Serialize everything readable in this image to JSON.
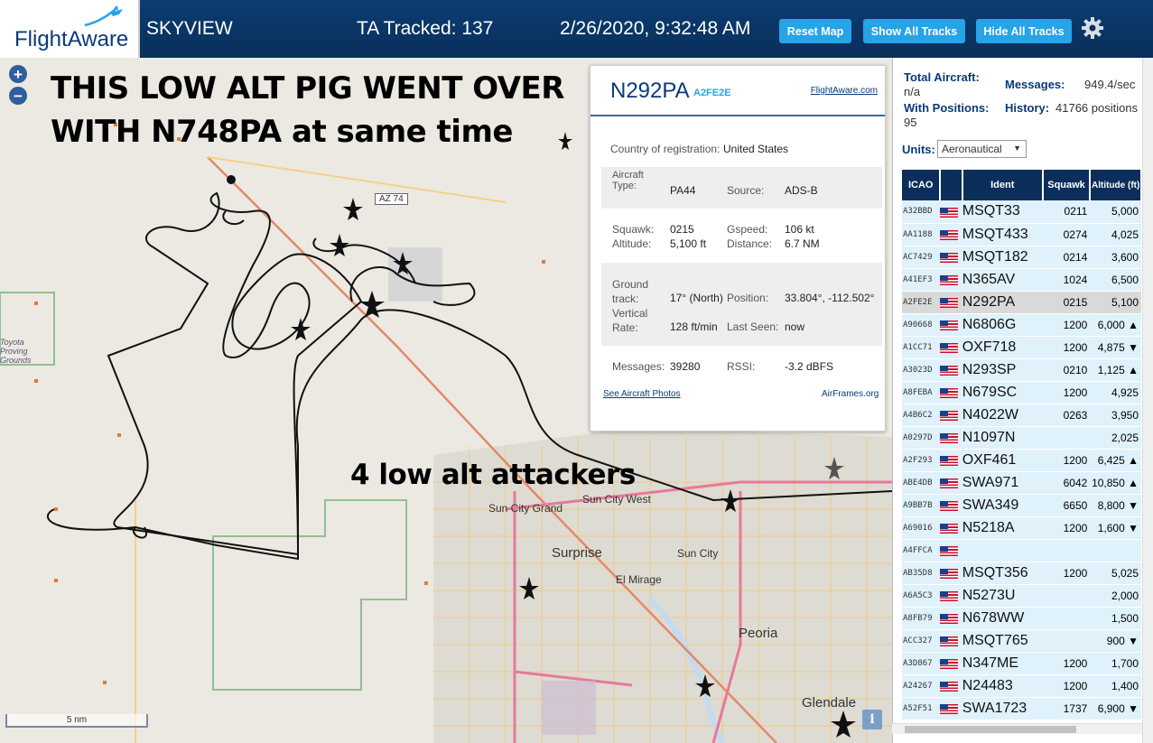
{
  "topbar": {
    "logo_text": "FlightAware",
    "app_name": "SKYVIEW",
    "tracked": "TA Tracked: 137",
    "datetime": "2/26/2020, 9:32:48 AM",
    "reset_map": "Reset Map",
    "show_all": "Show All Tracks",
    "hide_all": "Hide All Tracks",
    "settings_icon": "gear-icon"
  },
  "map": {
    "zoom_in": "+",
    "zoom_out": "−",
    "annotation_1": "THIS LOW ALT PIG WENT OVER",
    "annotation_2": "WITH N748PA at same time",
    "annotation_3": "4 low alt attackers",
    "scale": "5 nm",
    "info": "i",
    "places": {
      "toyota": "Toyota Proving Grounds",
      "sun_city_west": "Sun City West",
      "sun_city_grand": "Sun City Grand",
      "surprise": "Surprise",
      "sun_city": "Sun City",
      "el_mirage": "El Mirage",
      "peoria": "Peoria",
      "glendale": "Glendale",
      "az74": "AZ 74"
    }
  },
  "popup": {
    "registration": "N292PA",
    "hex": "A2FE2E",
    "fa_link": "FlightAware.com",
    "country_label": "Country of registration:",
    "country": "United States",
    "aircraft_type_label": "Aircraft Type:",
    "aircraft_type": "PA44",
    "source_label": "Source:",
    "source": "ADS-B",
    "squawk_label": "Squawk:",
    "squawk": "0215",
    "gspeed_label": "Gspeed:",
    "gspeed": "106 kt",
    "altitude_label": "Altitude:",
    "altitude": "5,100 ft",
    "distance_label": "Distance:",
    "distance": "6.7 NM",
    "track_label": "Ground track:",
    "track": "17° (North)",
    "position_label": "Position:",
    "position": "33.804°, -112.502°",
    "vrate_label": "Vertical Rate:",
    "vrate": "128 ft/min",
    "lastseen_label": "Last Seen:",
    "lastseen": "now",
    "messages_label": "Messages:",
    "messages": "39280",
    "rssi_label": "RSSI:",
    "rssi": "-3.2 dBFS",
    "photos_link": "See Aircraft Photos",
    "airframes_link": "AirFrames.org"
  },
  "sidebar": {
    "total_label": "Total Aircraft:",
    "total_value": "n/a",
    "messages_label": "Messages:",
    "messages_value": "949.4/sec",
    "withpos_label": "With Positions:",
    "withpos_value": "95",
    "history_label": "History:",
    "history_value": "41766 positions",
    "units_label": "Units:",
    "units_value": "Aeronautical",
    "columns": [
      "ICAO",
      "",
      "Ident",
      "Squawk",
      "Altitude (ft)"
    ],
    "rows": [
      {
        "icao": "A32BBD",
        "ident": "MSQT33",
        "squawk": "0211",
        "alt": "5,000"
      },
      {
        "icao": "AA1188",
        "ident": "MSQT433",
        "squawk": "0274",
        "alt": "4,025"
      },
      {
        "icao": "AC7429",
        "ident": "MSQT182",
        "squawk": "0214",
        "alt": "3,600"
      },
      {
        "icao": "A41EF3",
        "ident": "N365AV",
        "squawk": "1024",
        "alt": "6,500"
      },
      {
        "icao": "A2FE2E",
        "ident": "N292PA",
        "squawk": "0215",
        "alt": "5,100"
      },
      {
        "icao": "A90668",
        "ident": "N6806G",
        "squawk": "1200",
        "alt": "6,000 ▲"
      },
      {
        "icao": "A1CC71",
        "ident": "OXF718",
        "squawk": "1200",
        "alt": "4,875 ▼"
      },
      {
        "icao": "A3023D",
        "ident": "N293SP",
        "squawk": "0210",
        "alt": "1,125 ▲"
      },
      {
        "icao": "A8FEBA",
        "ident": "N679SC",
        "squawk": "1200",
        "alt": "4,925"
      },
      {
        "icao": "A4B6C2",
        "ident": "N4022W",
        "squawk": "0263",
        "alt": "3,950"
      },
      {
        "icao": "A0297D",
        "ident": "N1097N",
        "squawk": "",
        "alt": "2,025"
      },
      {
        "icao": "A2F293",
        "ident": "OXF461",
        "squawk": "1200",
        "alt": "6,425 ▲"
      },
      {
        "icao": "ABE4DB",
        "ident": "SWA971",
        "squawk": "6042",
        "alt": "10,850 ▲"
      },
      {
        "icao": "A9BB7B",
        "ident": "SWA349",
        "squawk": "6650",
        "alt": "8,800 ▼"
      },
      {
        "icao": "A69016",
        "ident": "N5218A",
        "squawk": "1200",
        "alt": "1,600 ▼"
      },
      {
        "icao": "A4FFCA",
        "ident": "",
        "squawk": "",
        "alt": ""
      },
      {
        "icao": "AB35D8",
        "ident": "MSQT356",
        "squawk": "1200",
        "alt": "5,025"
      },
      {
        "icao": "A6A5C3",
        "ident": "N5273U",
        "squawk": "",
        "alt": "2,000"
      },
      {
        "icao": "A8FB79",
        "ident": "N678WW",
        "squawk": "",
        "alt": "1,500"
      },
      {
        "icao": "ACC327",
        "ident": "MSQT765",
        "squawk": "",
        "alt": "900 ▼"
      },
      {
        "icao": "A3D867",
        "ident": "N347ME",
        "squawk": "1200",
        "alt": "1,700"
      },
      {
        "icao": "A24267",
        "ident": "N24483",
        "squawk": "1200",
        "alt": "1,400"
      },
      {
        "icao": "A52F51",
        "ident": "SWA1723",
        "squawk": "1737",
        "alt": "6,900 ▼"
      }
    ]
  }
}
